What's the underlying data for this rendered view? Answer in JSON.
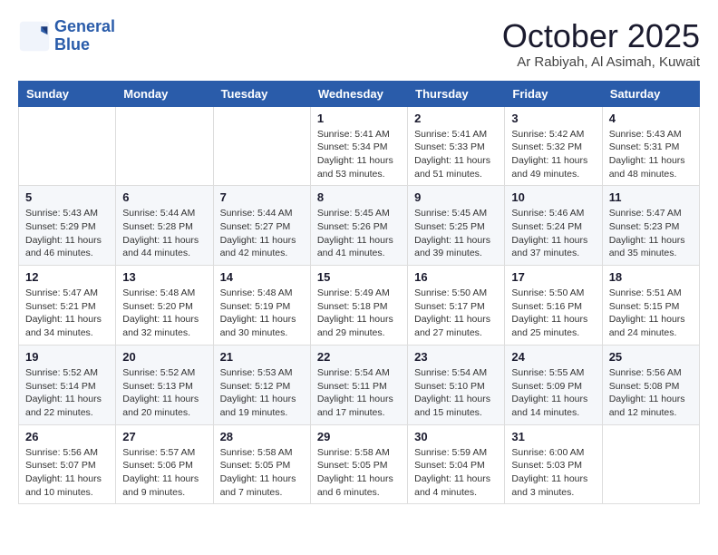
{
  "logo": {
    "line1": "General",
    "line2": "Blue"
  },
  "title": "October 2025",
  "location": "Ar Rabiyah, Al Asimah, Kuwait",
  "weekdays": [
    "Sunday",
    "Monday",
    "Tuesday",
    "Wednesday",
    "Thursday",
    "Friday",
    "Saturday"
  ],
  "weeks": [
    [
      {
        "day": "",
        "info": ""
      },
      {
        "day": "",
        "info": ""
      },
      {
        "day": "",
        "info": ""
      },
      {
        "day": "1",
        "info": "Sunrise: 5:41 AM\nSunset: 5:34 PM\nDaylight: 11 hours and 53 minutes."
      },
      {
        "day": "2",
        "info": "Sunrise: 5:41 AM\nSunset: 5:33 PM\nDaylight: 11 hours and 51 minutes."
      },
      {
        "day": "3",
        "info": "Sunrise: 5:42 AM\nSunset: 5:32 PM\nDaylight: 11 hours and 49 minutes."
      },
      {
        "day": "4",
        "info": "Sunrise: 5:43 AM\nSunset: 5:31 PM\nDaylight: 11 hours and 48 minutes."
      }
    ],
    [
      {
        "day": "5",
        "info": "Sunrise: 5:43 AM\nSunset: 5:29 PM\nDaylight: 11 hours and 46 minutes."
      },
      {
        "day": "6",
        "info": "Sunrise: 5:44 AM\nSunset: 5:28 PM\nDaylight: 11 hours and 44 minutes."
      },
      {
        "day": "7",
        "info": "Sunrise: 5:44 AM\nSunset: 5:27 PM\nDaylight: 11 hours and 42 minutes."
      },
      {
        "day": "8",
        "info": "Sunrise: 5:45 AM\nSunset: 5:26 PM\nDaylight: 11 hours and 41 minutes."
      },
      {
        "day": "9",
        "info": "Sunrise: 5:45 AM\nSunset: 5:25 PM\nDaylight: 11 hours and 39 minutes."
      },
      {
        "day": "10",
        "info": "Sunrise: 5:46 AM\nSunset: 5:24 PM\nDaylight: 11 hours and 37 minutes."
      },
      {
        "day": "11",
        "info": "Sunrise: 5:47 AM\nSunset: 5:23 PM\nDaylight: 11 hours and 35 minutes."
      }
    ],
    [
      {
        "day": "12",
        "info": "Sunrise: 5:47 AM\nSunset: 5:21 PM\nDaylight: 11 hours and 34 minutes."
      },
      {
        "day": "13",
        "info": "Sunrise: 5:48 AM\nSunset: 5:20 PM\nDaylight: 11 hours and 32 minutes."
      },
      {
        "day": "14",
        "info": "Sunrise: 5:48 AM\nSunset: 5:19 PM\nDaylight: 11 hours and 30 minutes."
      },
      {
        "day": "15",
        "info": "Sunrise: 5:49 AM\nSunset: 5:18 PM\nDaylight: 11 hours and 29 minutes."
      },
      {
        "day": "16",
        "info": "Sunrise: 5:50 AM\nSunset: 5:17 PM\nDaylight: 11 hours and 27 minutes."
      },
      {
        "day": "17",
        "info": "Sunrise: 5:50 AM\nSunset: 5:16 PM\nDaylight: 11 hours and 25 minutes."
      },
      {
        "day": "18",
        "info": "Sunrise: 5:51 AM\nSunset: 5:15 PM\nDaylight: 11 hours and 24 minutes."
      }
    ],
    [
      {
        "day": "19",
        "info": "Sunrise: 5:52 AM\nSunset: 5:14 PM\nDaylight: 11 hours and 22 minutes."
      },
      {
        "day": "20",
        "info": "Sunrise: 5:52 AM\nSunset: 5:13 PM\nDaylight: 11 hours and 20 minutes."
      },
      {
        "day": "21",
        "info": "Sunrise: 5:53 AM\nSunset: 5:12 PM\nDaylight: 11 hours and 19 minutes."
      },
      {
        "day": "22",
        "info": "Sunrise: 5:54 AM\nSunset: 5:11 PM\nDaylight: 11 hours and 17 minutes."
      },
      {
        "day": "23",
        "info": "Sunrise: 5:54 AM\nSunset: 5:10 PM\nDaylight: 11 hours and 15 minutes."
      },
      {
        "day": "24",
        "info": "Sunrise: 5:55 AM\nSunset: 5:09 PM\nDaylight: 11 hours and 14 minutes."
      },
      {
        "day": "25",
        "info": "Sunrise: 5:56 AM\nSunset: 5:08 PM\nDaylight: 11 hours and 12 minutes."
      }
    ],
    [
      {
        "day": "26",
        "info": "Sunrise: 5:56 AM\nSunset: 5:07 PM\nDaylight: 11 hours and 10 minutes."
      },
      {
        "day": "27",
        "info": "Sunrise: 5:57 AM\nSunset: 5:06 PM\nDaylight: 11 hours and 9 minutes."
      },
      {
        "day": "28",
        "info": "Sunrise: 5:58 AM\nSunset: 5:05 PM\nDaylight: 11 hours and 7 minutes."
      },
      {
        "day": "29",
        "info": "Sunrise: 5:58 AM\nSunset: 5:05 PM\nDaylight: 11 hours and 6 minutes."
      },
      {
        "day": "30",
        "info": "Sunrise: 5:59 AM\nSunset: 5:04 PM\nDaylight: 11 hours and 4 minutes."
      },
      {
        "day": "31",
        "info": "Sunrise: 6:00 AM\nSunset: 5:03 PM\nDaylight: 11 hours and 3 minutes."
      },
      {
        "day": "",
        "info": ""
      }
    ]
  ]
}
